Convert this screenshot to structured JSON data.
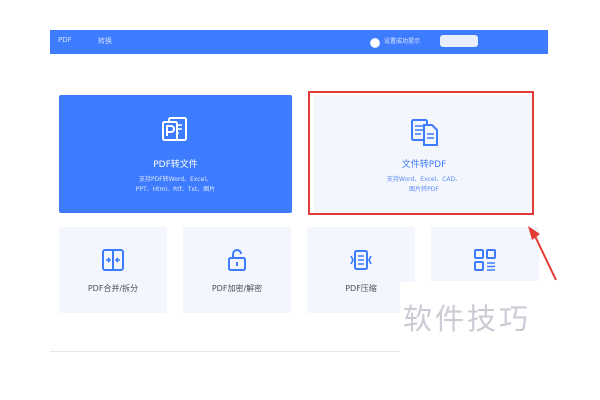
{
  "topbar": {
    "radio_label": "设置成功提示",
    "blur_left": "PDF",
    "blur_left2": "转换"
  },
  "cards": {
    "pdf_to_file": {
      "title": "PDF转文件",
      "desc_line1": "支持PDF转Word、Excel、",
      "desc_line2": "PPT、Html、Rtf、Txt、图片",
      "icon": "pdf-document-icon"
    },
    "file_to_pdf": {
      "title": "文件转PDF",
      "desc_line1": "支持Word、Excel、CAD、",
      "desc_line2": "图片转PDF",
      "icon": "file-document-icon"
    },
    "merge_split": {
      "title": "PDF合并/拆分",
      "icon": "merge-split-icon"
    },
    "encrypt_decrypt": {
      "title": "PDF加密/解密",
      "icon": "unlock-icon"
    },
    "compress": {
      "title": "PDF压缩",
      "icon": "compress-icon"
    },
    "more": {
      "icon": "apps-grid-icon"
    }
  },
  "watermark": "软件技巧",
  "colors": {
    "primary": "#3d7bff",
    "card_bg": "#f3f6fc",
    "highlight": "#e23b36",
    "watermark": "#c9ccd4"
  }
}
